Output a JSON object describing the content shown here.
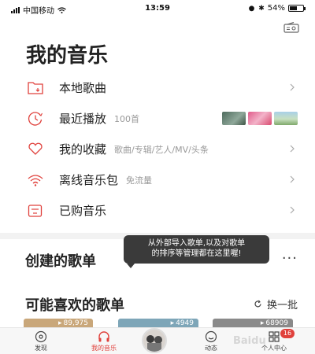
{
  "status_bar": {
    "carrier": "中国移动",
    "time": "13:59",
    "battery": "54%",
    "battery_level": 0.54
  },
  "title": "我的音乐",
  "menu": [
    {
      "label": "本地歌曲",
      "sub": "",
      "icon": "folder-icon"
    },
    {
      "label": "最近播放",
      "sub": "100首",
      "icon": "clock-icon"
    },
    {
      "label": "我的收藏",
      "sub": "歌曲/专辑/艺人/MV/头条",
      "icon": "heart-icon"
    },
    {
      "label": "离线音乐包",
      "sub": "免流量",
      "icon": "wifi-icon"
    },
    {
      "label": "已购音乐",
      "sub": "",
      "icon": "purchased-icon"
    }
  ],
  "created": {
    "title": "创建的歌单",
    "more": "···"
  },
  "tooltip": {
    "line1": "从外部导入歌单,以及对歌单",
    "line2": "的排序等管理都在这里喔!"
  },
  "likes": {
    "title": "可能喜欢的歌单",
    "refresh_label": "换一批"
  },
  "cards": [
    {
      "count": "89,975",
      "color": "#c9a77a"
    },
    {
      "count": "4949",
      "color": "#7ea6b8"
    },
    {
      "count": "68909",
      "color": "#8a8a8a"
    }
  ],
  "tabs": [
    {
      "label": "发现",
      "icon": "discover-icon"
    },
    {
      "label": "我的音乐",
      "icon": "headphones-icon"
    },
    {
      "label": "动态",
      "icon": "smile-icon"
    },
    {
      "label": "个人中心",
      "icon": "profile-icon"
    }
  ],
  "badge": "16",
  "watermark": "Baidu",
  "colors": {
    "accent": "#e0413c",
    "tooltip_bg": "#3a3a3a",
    "divider": "#f2f2f2"
  }
}
